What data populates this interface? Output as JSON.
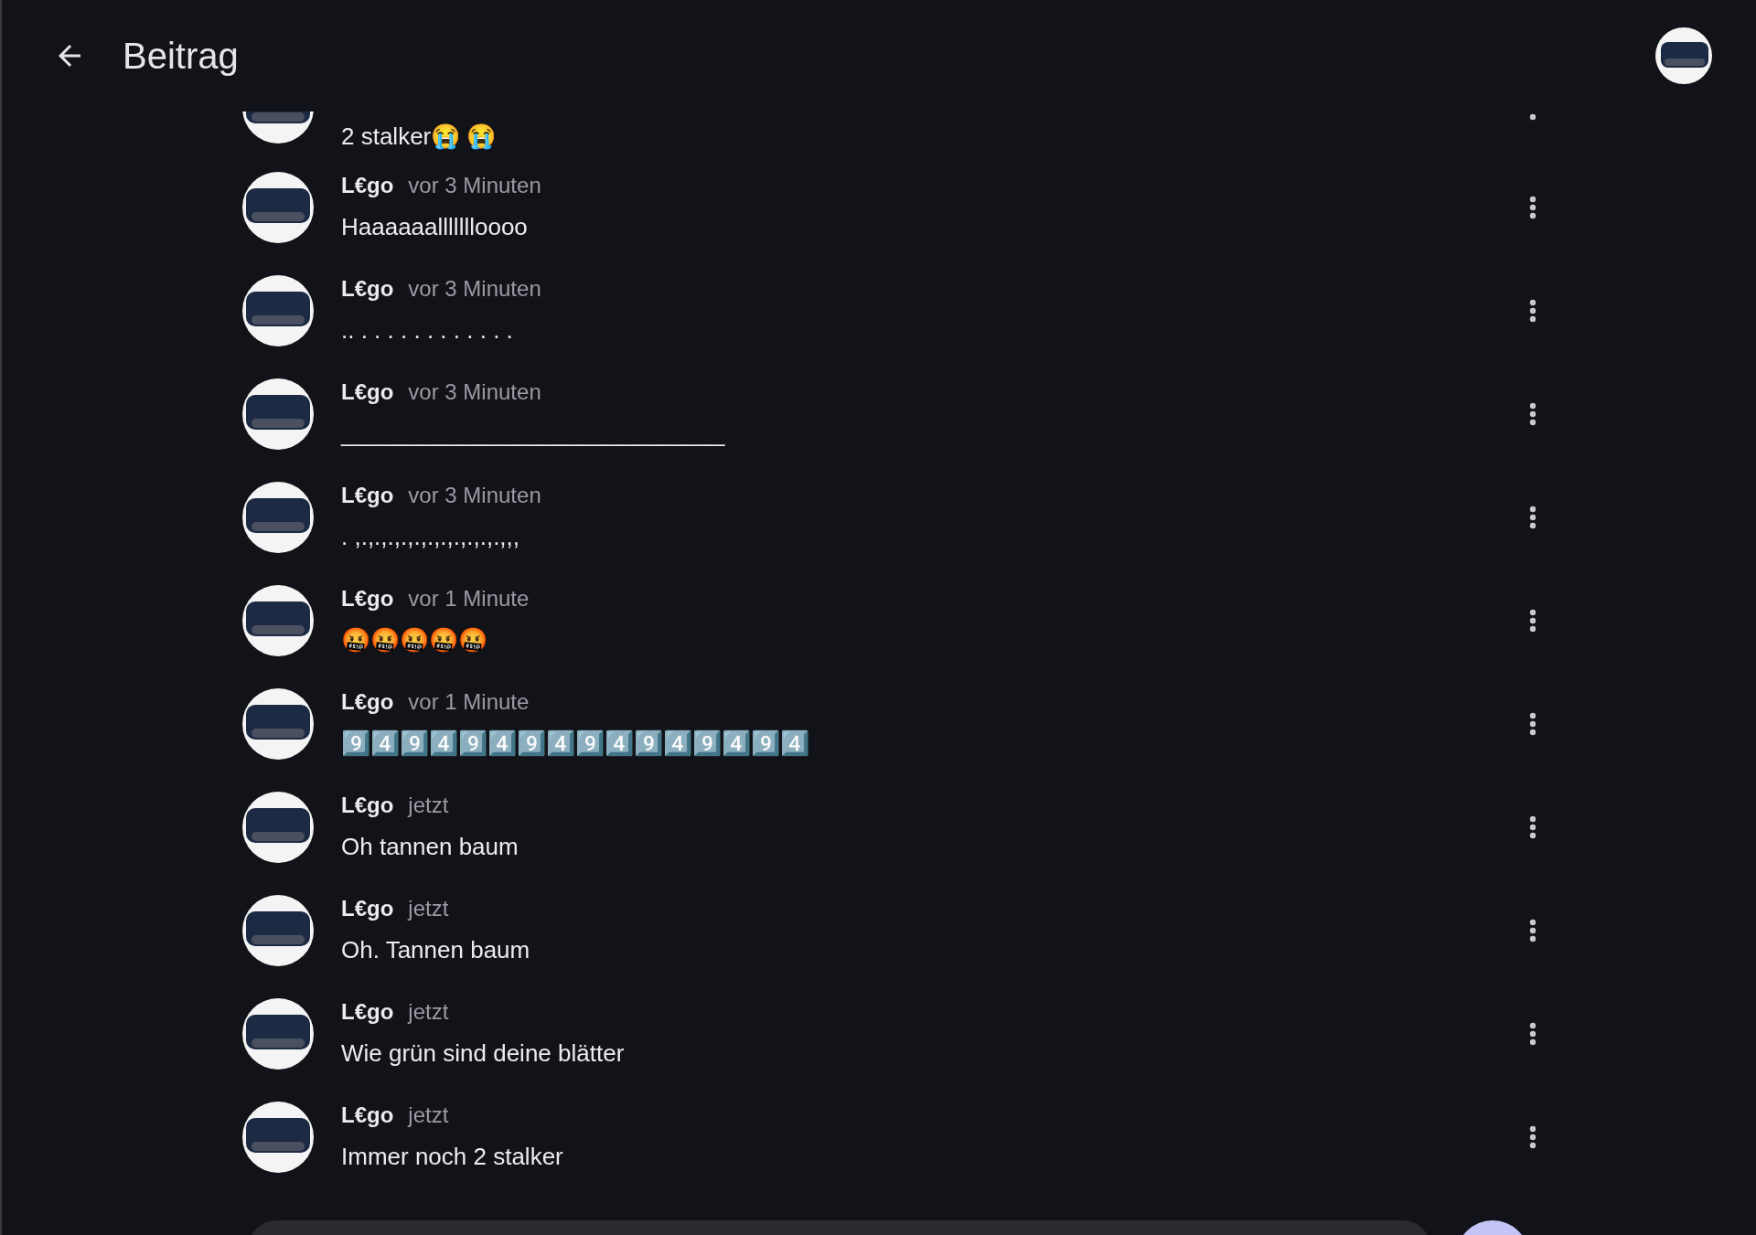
{
  "header": {
    "title": "Beitrag"
  },
  "comments": [
    {
      "text": "2 stalker😭 😭"
    },
    {
      "author": "L€go",
      "time": "vor 3 Minuten",
      "text": "Haaaaaallllllloooo"
    },
    {
      "author": "L€go",
      "time": "vor 3 Minuten",
      "text": ".. . . . . . . . . . . . ."
    },
    {
      "author": "L€go",
      "time": "vor 3 Minuten",
      "text": "_____________________________"
    },
    {
      "author": "L€go",
      "time": "vor 3 Minuten",
      "text": ". ,.,.,.,.,.,.,.,.,.,.,.,,,"
    },
    {
      "author": "L€go",
      "time": "vor 1 Minute",
      "text": "🤬🤬🤬🤬🤬"
    },
    {
      "author": "L€go",
      "time": "vor 1 Minute",
      "text": "9️⃣4️⃣9️⃣4️⃣9️⃣4️⃣9️⃣4️⃣9️⃣4️⃣9️⃣4️⃣9️⃣4️⃣9️⃣4️⃣"
    },
    {
      "author": "L€go",
      "time": "jetzt",
      "text": "Oh tannen baum"
    },
    {
      "author": "L€go",
      "time": "jetzt",
      "text": "Oh. Tannen baum"
    },
    {
      "author": "L€go",
      "time": "jetzt",
      "text": "Wie grün sind deine blätter"
    },
    {
      "author": "L€go",
      "time": "jetzt",
      "text": "Immer noch 2 stalker"
    }
  ]
}
